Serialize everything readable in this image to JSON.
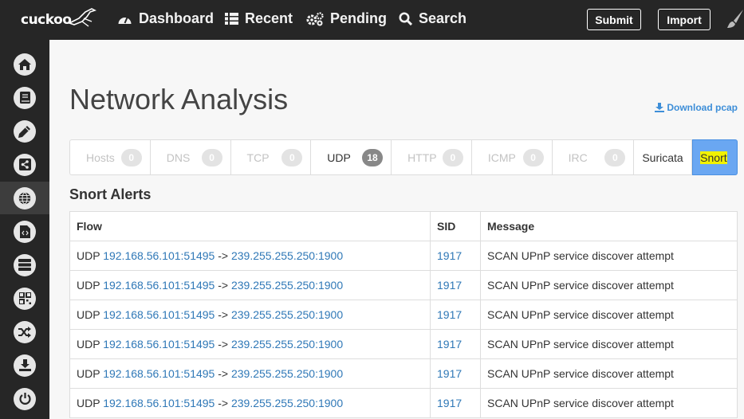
{
  "brand": {
    "name": "cuckoo"
  },
  "nav": [
    {
      "label": "Dashboard",
      "icon": "dashboard-icon"
    },
    {
      "label": "Recent",
      "icon": "list-icon"
    },
    {
      "label": "Pending",
      "icon": "cogs-icon"
    },
    {
      "label": "Search",
      "icon": "search-icon"
    }
  ],
  "buttons": {
    "submit": "Submit",
    "import": "Import"
  },
  "sidebar": [
    {
      "icon": "home-icon"
    },
    {
      "icon": "book-icon"
    },
    {
      "icon": "pencil-icon"
    },
    {
      "icon": "share-icon"
    },
    {
      "icon": "globe-icon",
      "active": true
    },
    {
      "icon": "file-code-icon"
    },
    {
      "icon": "server-icon"
    },
    {
      "icon": "qrcode-icon"
    },
    {
      "icon": "shuffle-icon"
    },
    {
      "icon": "download-icon"
    },
    {
      "icon": "power-icon"
    }
  ],
  "page": {
    "title": "Network Analysis",
    "download_label": "Download pcap"
  },
  "tabs": [
    {
      "label": "Hosts",
      "count": "0"
    },
    {
      "label": "DNS",
      "count": "0"
    },
    {
      "label": "TCP",
      "count": "0"
    },
    {
      "label": "UDP",
      "count": "18"
    },
    {
      "label": "HTTP",
      "count": "0"
    },
    {
      "label": "ICMP",
      "count": "0"
    },
    {
      "label": "IRC",
      "count": "0"
    },
    {
      "label": "Suricata"
    },
    {
      "label": "Snort"
    }
  ],
  "section": {
    "title": "Snort Alerts"
  },
  "table": {
    "headers": [
      "Flow",
      "SID",
      "Message"
    ],
    "rows": [
      {
        "proto": "UDP",
        "src": "192.168.56.101:51495",
        "arrow": "->",
        "dst": "239.255.255.250:1900",
        "sid": "1917",
        "message": "SCAN UPnP service discover attempt"
      },
      {
        "proto": "UDP",
        "src": "192.168.56.101:51495",
        "arrow": "->",
        "dst": "239.255.255.250:1900",
        "sid": "1917",
        "message": "SCAN UPnP service discover attempt"
      },
      {
        "proto": "UDP",
        "src": "192.168.56.101:51495",
        "arrow": "->",
        "dst": "239.255.255.250:1900",
        "sid": "1917",
        "message": "SCAN UPnP service discover attempt"
      },
      {
        "proto": "UDP",
        "src": "192.168.56.101:51495",
        "arrow": "->",
        "dst": "239.255.255.250:1900",
        "sid": "1917",
        "message": "SCAN UPnP service discover attempt"
      },
      {
        "proto": "UDP",
        "src": "192.168.56.101:51495",
        "arrow": "->",
        "dst": "239.255.255.250:1900",
        "sid": "1917",
        "message": "SCAN UPnP service discover attempt"
      },
      {
        "proto": "UDP",
        "src": "192.168.56.101:51495",
        "arrow": "->",
        "dst": "239.255.255.250:1900",
        "sid": "1917",
        "message": "SCAN UPnP service discover attempt"
      }
    ]
  },
  "colors": {
    "topbar": "#262626",
    "link": "#2f78b7",
    "active_tab": "#6aa7f2",
    "highlight": "#f2f200"
  }
}
